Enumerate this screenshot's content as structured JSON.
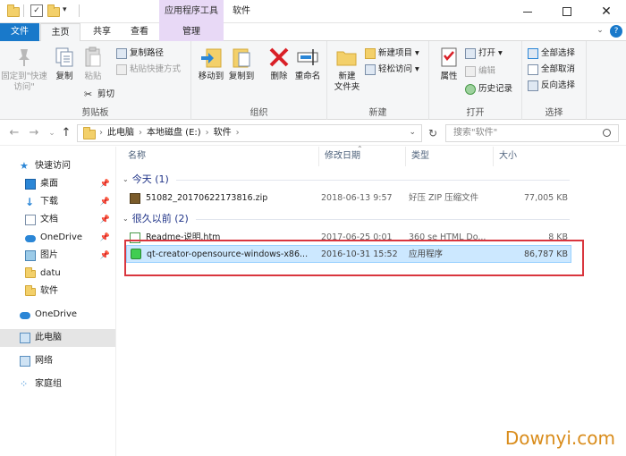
{
  "titlebar": {
    "context_group": "应用程序工具",
    "title": "软件",
    "help": "?"
  },
  "tabs": {
    "file": "文件",
    "home": "主页",
    "share": "共享",
    "view": "查看",
    "manage": "管理"
  },
  "ribbon": {
    "clipboard": {
      "label": "剪贴板",
      "pin": "固定到\"快速访问\"",
      "copy": "复制",
      "paste": "粘贴",
      "copy_path": "复制路径",
      "paste_shortcut": "粘贴快捷方式",
      "cut": "剪切"
    },
    "organize": {
      "label": "组织",
      "move_to": "移动到",
      "copy_to": "复制到",
      "delete": "删除",
      "rename": "重命名"
    },
    "new": {
      "label": "新建",
      "new_folder": "新建\n文件夹",
      "new_item": "新建项目 ▾",
      "easy_access": "轻松访问 ▾"
    },
    "open": {
      "label": "打开",
      "properties": "属性",
      "open": "打开 ▾",
      "edit": "编辑",
      "history": "历史记录"
    },
    "select": {
      "label": "选择",
      "select_all": "全部选择",
      "select_none": "全部取消",
      "invert": "反向选择"
    }
  },
  "address": {
    "path": [
      "此电脑",
      "本地磁盘 (E:)",
      "软件"
    ],
    "search_placeholder": "搜索\"软件\""
  },
  "nav": [
    {
      "label": "快速访问",
      "pinned": false
    },
    {
      "label": "桌面",
      "pinned": true
    },
    {
      "label": "下载",
      "pinned": true
    },
    {
      "label": "文档",
      "pinned": true
    },
    {
      "label": "OneDrive",
      "pinned": true
    },
    {
      "label": "图片",
      "pinned": true
    },
    {
      "label": "datu",
      "pinned": false
    },
    {
      "label": "软件",
      "pinned": false
    },
    {
      "label": "OneDrive",
      "pinned": false
    },
    {
      "label": "此电脑",
      "pinned": false
    },
    {
      "label": "网络",
      "pinned": false
    },
    {
      "label": "家庭组",
      "pinned": false
    }
  ],
  "columns": {
    "name": "名称",
    "date": "修改日期",
    "type": "类型",
    "size": "大小"
  },
  "groups": [
    {
      "title": "今天 (1)",
      "files": [
        {
          "name": "51082_20170622173816.zip",
          "date": "2018-06-13 9:57",
          "type": "好压 ZIP 压缩文件",
          "size": "77,005 KB"
        }
      ]
    },
    {
      "title": "很久以前 (2)",
      "files": [
        {
          "name": "Readme-说明.htm",
          "date": "2017-06-25 0:01",
          "type": "360 se HTML Do...",
          "size": "8 KB"
        },
        {
          "name": "qt-creator-opensource-windows-x86...",
          "date": "2016-10-31 15:52",
          "type": "应用程序",
          "size": "86,787 KB"
        }
      ]
    }
  ],
  "watermark": "Downyi.com"
}
